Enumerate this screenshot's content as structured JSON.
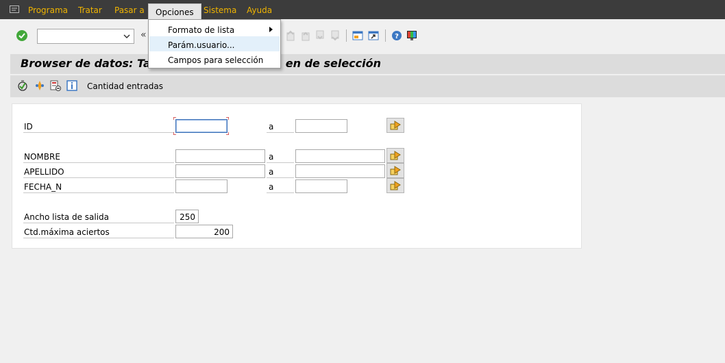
{
  "menubar": {
    "items": [
      "Programa",
      "Tratar",
      "Pasar a",
      "Opciones",
      "Sistema",
      "Ayuda"
    ],
    "active": "Opciones"
  },
  "toolbar": {
    "command_value": "",
    "nav_glyph": "«"
  },
  "dropdown": {
    "items": [
      "Formato de lista",
      "Parám.usuario...",
      "Campos para selección"
    ],
    "highlighted": "Parám.usuario..."
  },
  "title": {
    "visible_left": "Browser de datos: Ta",
    "visible_right": "en de selección"
  },
  "app_toolbar": {
    "label": "Cantidad entradas"
  },
  "selection": {
    "rows": [
      {
        "label": "ID",
        "to_label": "a",
        "from_value": "",
        "to_value": ""
      },
      {
        "label": "NOMBRE",
        "to_label": "a",
        "from_value": "",
        "to_value": ""
      },
      {
        "label": "APELLIDO",
        "to_label": "a",
        "from_value": "",
        "to_value": ""
      },
      {
        "label": "FECHA_N",
        "to_label": "a",
        "from_value": "",
        "to_value": ""
      }
    ],
    "settings": [
      {
        "label": "Ancho lista de salida",
        "value": "250"
      },
      {
        "label": "Ctd.máxima aciertos",
        "value": "200"
      }
    ]
  },
  "colors": {
    "menubar_bg": "#3c3c3c",
    "menu_text": "#f0b400",
    "check": "#42a83a",
    "highlight": "#e3f0fa"
  }
}
